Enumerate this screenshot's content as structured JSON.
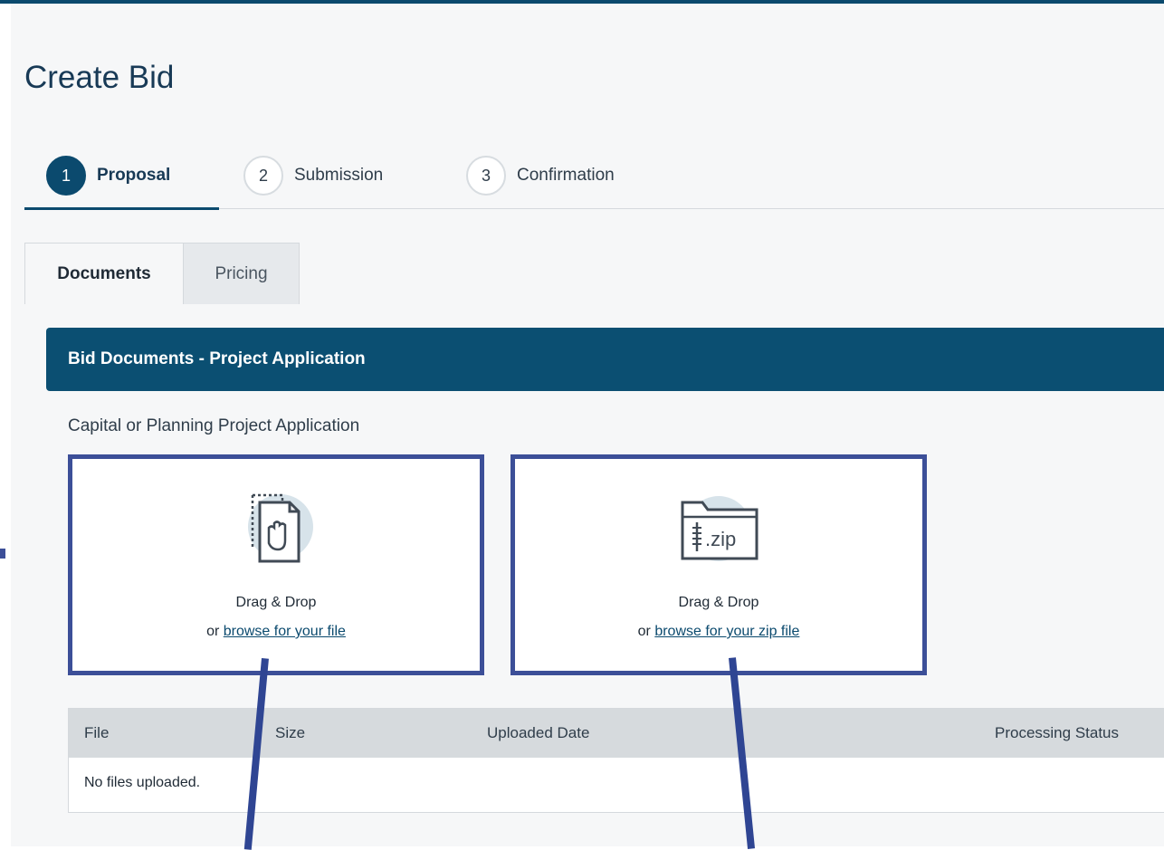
{
  "page": {
    "title": "Create Bid"
  },
  "stepper": {
    "steps": [
      {
        "number": "1",
        "label": "Proposal"
      },
      {
        "number": "2",
        "label": "Submission"
      },
      {
        "number": "3",
        "label": "Confirmation"
      }
    ]
  },
  "tabs": [
    {
      "label": "Documents"
    },
    {
      "label": "Pricing"
    }
  ],
  "panel": {
    "header": "Bid Documents - Project Application",
    "section_label": "Capital or Planning Project Application"
  },
  "upload": {
    "file": {
      "title": "Drag & Drop",
      "prefix": "or",
      "link": "browse for your file",
      "icon": "drag-drop-file-icon"
    },
    "zip": {
      "title": "Drag & Drop",
      "prefix": "or",
      "link": "browse for your zip file",
      "icon": "zip-folder-icon",
      "icon_text": ".zip"
    }
  },
  "table": {
    "columns": [
      "File",
      "Size",
      "Uploaded Date",
      "Processing Status"
    ],
    "empty_message": "No files uploaded."
  },
  "colors": {
    "primary": "#0b4a6e",
    "annotation": "#3c4f98"
  }
}
